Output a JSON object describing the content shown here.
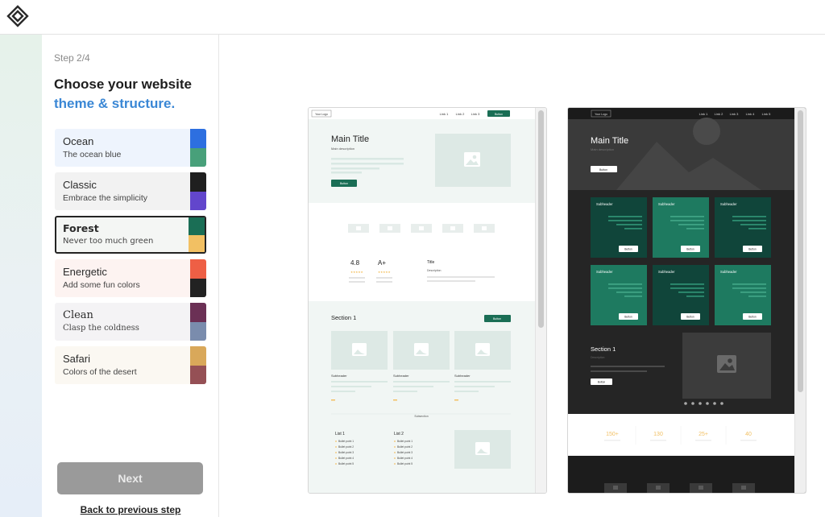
{
  "step": "Step 2/4",
  "heading": {
    "line1": "Choose your website",
    "line2": "theme & structure."
  },
  "themes": [
    {
      "name": "Ocean",
      "desc": "The ocean blue",
      "bg": "#eef4fd",
      "c1": "#2d6fe0",
      "c2": "#48a07a"
    },
    {
      "name": "Classic",
      "desc": "Embrace the simplicity",
      "bg": "#f2f2f2",
      "c1": "#1f1f1f",
      "c2": "#6246cc"
    },
    {
      "name": "Forest",
      "desc": "Never too much green",
      "bg": "#f4f6f4",
      "c1": "#1a6e55",
      "c2": "#f2c063"
    },
    {
      "name": "Energetic",
      "desc": "Add some fun colors",
      "bg": "#fdf3f1",
      "c1": "#ee5f45",
      "c2": "#222222"
    },
    {
      "name": "Clean",
      "desc": "Clasp the coldness",
      "bg": "#f4f3f5",
      "c1": "#6b3055",
      "c2": "#7a8cad"
    },
    {
      "name": "Safari",
      "desc": "Colors of the desert",
      "bg": "#fbf8f2",
      "c1": "#d9a85a",
      "c2": "#955055"
    }
  ],
  "selected_theme": "Forest",
  "next_label": "Next",
  "back_label": "Back to previous step",
  "preview_light": {
    "logo": "Your Logo",
    "nav_links": [
      "Link 1",
      "Link 2",
      "Link 3"
    ],
    "nav_button": "Button",
    "hero_title": "Main Title",
    "hero_desc": "Main description",
    "hero_button": "Button",
    "stat1": "4.8",
    "stat2": "A+",
    "stars": "★★★★★",
    "stats_title": "Title",
    "stats_desc": "Description",
    "section_title": "Section 1",
    "section_button": "Button",
    "card_subheader": "Subheader",
    "subsection": "Subsection",
    "list1_title": "List 1",
    "list2_title": "List 2",
    "bullets": [
      "Bullet point 1",
      "Bullet point 2",
      "Bullet point 3",
      "Bullet point 4",
      "Bullet point 5"
    ]
  },
  "preview_dark": {
    "logo": "Your Logo",
    "nav_links": [
      "Link 1",
      "Link 2",
      "Link 3",
      "Link 4",
      "Link 5"
    ],
    "hero_title": "Main Title",
    "hero_desc": "Main description",
    "hero_button": "Button",
    "card_subheader": "Subheader",
    "card_button": "Button",
    "section_title": "Section 1",
    "section_desc": "Description",
    "section_button": "Button",
    "stats": [
      "150+",
      "130",
      "25+",
      "40"
    ]
  },
  "colors": {
    "accent": "#3a87d5",
    "forest": "#1a6e55",
    "forest_light": "#1f8066",
    "next_disabled": "#9a9a9a"
  }
}
